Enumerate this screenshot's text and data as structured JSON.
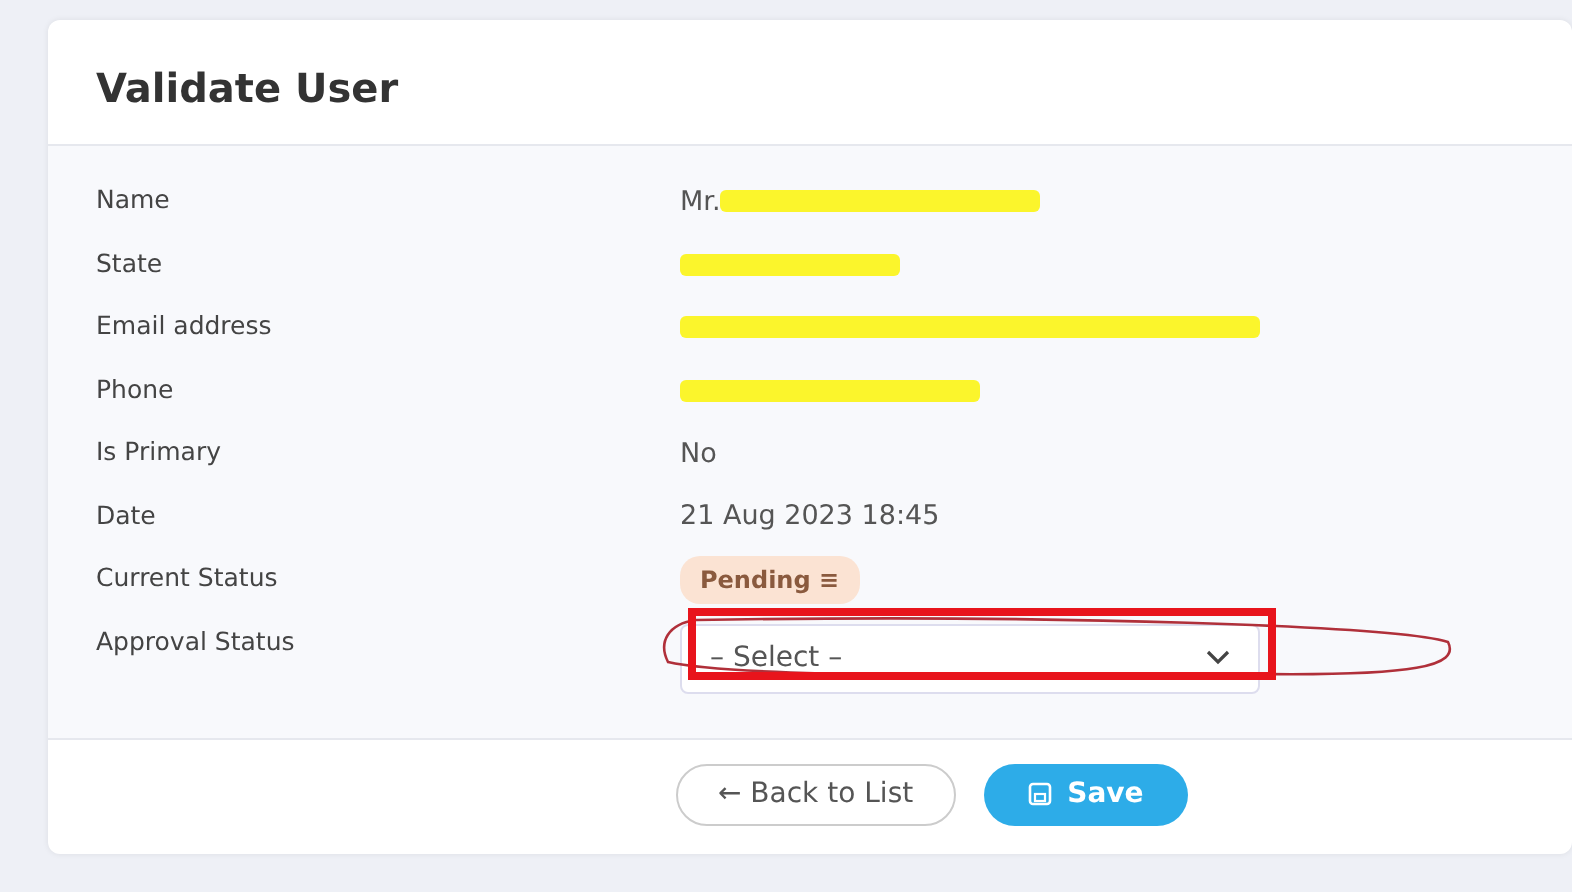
{
  "card": {
    "title": "Validate User"
  },
  "fields": [
    {
      "kind": "text",
      "label": "Name",
      "value": "Mr.",
      "redacted": true
    },
    {
      "kind": "text",
      "label": "State",
      "redacted": true
    },
    {
      "kind": "text",
      "label": "Email address",
      "redacted": true
    },
    {
      "kind": "text",
      "label": "Phone",
      "redacted": true
    },
    {
      "kind": "text",
      "label": "Is Primary",
      "value": "No",
      "redacted": false
    },
    {
      "kind": "text",
      "label": "Date",
      "value": "21 Aug 2023 18:45",
      "redacted": false
    },
    {
      "kind": "badge",
      "label": "Current Status",
      "value": "Pending ≡"
    },
    {
      "kind": "select",
      "label": "Approval Status",
      "value": "– Select –",
      "annotated": true
    }
  ],
  "buttons": [
    {
      "kind": "back",
      "label": "← Back to List"
    },
    {
      "kind": "save",
      "label": "Save"
    }
  ]
}
